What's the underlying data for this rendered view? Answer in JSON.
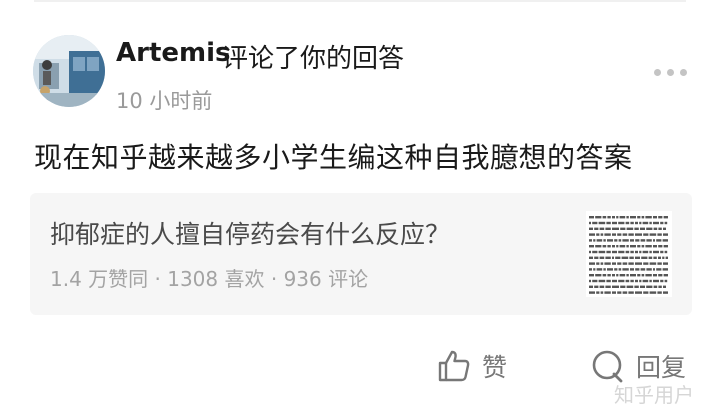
{
  "notification": {
    "username": "Artemis",
    "action_text": "评论了你的回答",
    "time": "10 小时前"
  },
  "comment": {
    "text": "现在知乎越来越多小学生编这种自我臆想的答案"
  },
  "answer_card": {
    "title": "抑郁症的人擅自停药会有什么反应？",
    "stats": "1.4 万赞同 · 1308 喜欢 · 936 评论"
  },
  "actions": {
    "like_label": "赞",
    "reply_label": "回复"
  },
  "watermark": "知乎用户",
  "icons": {
    "more": "more-dots-icon",
    "like": "thumbs-up-icon",
    "reply": "reply-bubble-icon"
  },
  "colors": {
    "primary_text": "#1a1a1a",
    "secondary_text": "#9a9a9a",
    "card_background": "#f6f6f6",
    "action_text": "#777777"
  }
}
